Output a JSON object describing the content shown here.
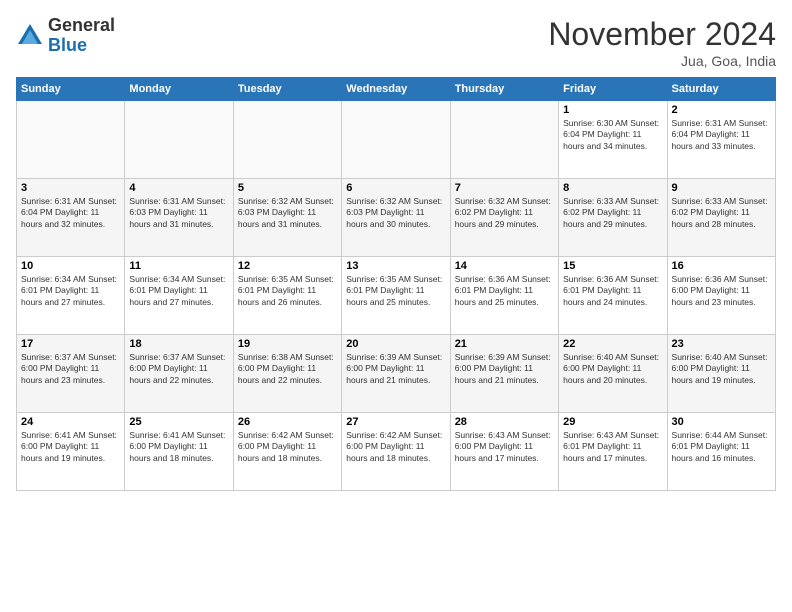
{
  "logo": {
    "general": "General",
    "blue": "Blue"
  },
  "title": "November 2024",
  "location": "Jua, Goa, India",
  "days_header": [
    "Sunday",
    "Monday",
    "Tuesday",
    "Wednesday",
    "Thursday",
    "Friday",
    "Saturday"
  ],
  "weeks": [
    [
      {
        "day": "",
        "info": ""
      },
      {
        "day": "",
        "info": ""
      },
      {
        "day": "",
        "info": ""
      },
      {
        "day": "",
        "info": ""
      },
      {
        "day": "",
        "info": ""
      },
      {
        "day": "1",
        "info": "Sunrise: 6:30 AM\nSunset: 6:04 PM\nDaylight: 11 hours and 34 minutes."
      },
      {
        "day": "2",
        "info": "Sunrise: 6:31 AM\nSunset: 6:04 PM\nDaylight: 11 hours and 33 minutes."
      }
    ],
    [
      {
        "day": "3",
        "info": "Sunrise: 6:31 AM\nSunset: 6:04 PM\nDaylight: 11 hours and 32 minutes."
      },
      {
        "day": "4",
        "info": "Sunrise: 6:31 AM\nSunset: 6:03 PM\nDaylight: 11 hours and 31 minutes."
      },
      {
        "day": "5",
        "info": "Sunrise: 6:32 AM\nSunset: 6:03 PM\nDaylight: 11 hours and 31 minutes."
      },
      {
        "day": "6",
        "info": "Sunrise: 6:32 AM\nSunset: 6:03 PM\nDaylight: 11 hours and 30 minutes."
      },
      {
        "day": "7",
        "info": "Sunrise: 6:32 AM\nSunset: 6:02 PM\nDaylight: 11 hours and 29 minutes."
      },
      {
        "day": "8",
        "info": "Sunrise: 6:33 AM\nSunset: 6:02 PM\nDaylight: 11 hours and 29 minutes."
      },
      {
        "day": "9",
        "info": "Sunrise: 6:33 AM\nSunset: 6:02 PM\nDaylight: 11 hours and 28 minutes."
      }
    ],
    [
      {
        "day": "10",
        "info": "Sunrise: 6:34 AM\nSunset: 6:01 PM\nDaylight: 11 hours and 27 minutes."
      },
      {
        "day": "11",
        "info": "Sunrise: 6:34 AM\nSunset: 6:01 PM\nDaylight: 11 hours and 27 minutes."
      },
      {
        "day": "12",
        "info": "Sunrise: 6:35 AM\nSunset: 6:01 PM\nDaylight: 11 hours and 26 minutes."
      },
      {
        "day": "13",
        "info": "Sunrise: 6:35 AM\nSunset: 6:01 PM\nDaylight: 11 hours and 25 minutes."
      },
      {
        "day": "14",
        "info": "Sunrise: 6:36 AM\nSunset: 6:01 PM\nDaylight: 11 hours and 25 minutes."
      },
      {
        "day": "15",
        "info": "Sunrise: 6:36 AM\nSunset: 6:01 PM\nDaylight: 11 hours and 24 minutes."
      },
      {
        "day": "16",
        "info": "Sunrise: 6:36 AM\nSunset: 6:00 PM\nDaylight: 11 hours and 23 minutes."
      }
    ],
    [
      {
        "day": "17",
        "info": "Sunrise: 6:37 AM\nSunset: 6:00 PM\nDaylight: 11 hours and 23 minutes."
      },
      {
        "day": "18",
        "info": "Sunrise: 6:37 AM\nSunset: 6:00 PM\nDaylight: 11 hours and 22 minutes."
      },
      {
        "day": "19",
        "info": "Sunrise: 6:38 AM\nSunset: 6:00 PM\nDaylight: 11 hours and 22 minutes."
      },
      {
        "day": "20",
        "info": "Sunrise: 6:39 AM\nSunset: 6:00 PM\nDaylight: 11 hours and 21 minutes."
      },
      {
        "day": "21",
        "info": "Sunrise: 6:39 AM\nSunset: 6:00 PM\nDaylight: 11 hours and 21 minutes."
      },
      {
        "day": "22",
        "info": "Sunrise: 6:40 AM\nSunset: 6:00 PM\nDaylight: 11 hours and 20 minutes."
      },
      {
        "day": "23",
        "info": "Sunrise: 6:40 AM\nSunset: 6:00 PM\nDaylight: 11 hours and 19 minutes."
      }
    ],
    [
      {
        "day": "24",
        "info": "Sunrise: 6:41 AM\nSunset: 6:00 PM\nDaylight: 11 hours and 19 minutes."
      },
      {
        "day": "25",
        "info": "Sunrise: 6:41 AM\nSunset: 6:00 PM\nDaylight: 11 hours and 18 minutes."
      },
      {
        "day": "26",
        "info": "Sunrise: 6:42 AM\nSunset: 6:00 PM\nDaylight: 11 hours and 18 minutes."
      },
      {
        "day": "27",
        "info": "Sunrise: 6:42 AM\nSunset: 6:00 PM\nDaylight: 11 hours and 18 minutes."
      },
      {
        "day": "28",
        "info": "Sunrise: 6:43 AM\nSunset: 6:00 PM\nDaylight: 11 hours and 17 minutes."
      },
      {
        "day": "29",
        "info": "Sunrise: 6:43 AM\nSunset: 6:01 PM\nDaylight: 11 hours and 17 minutes."
      },
      {
        "day": "30",
        "info": "Sunrise: 6:44 AM\nSunset: 6:01 PM\nDaylight: 11 hours and 16 minutes."
      }
    ]
  ]
}
